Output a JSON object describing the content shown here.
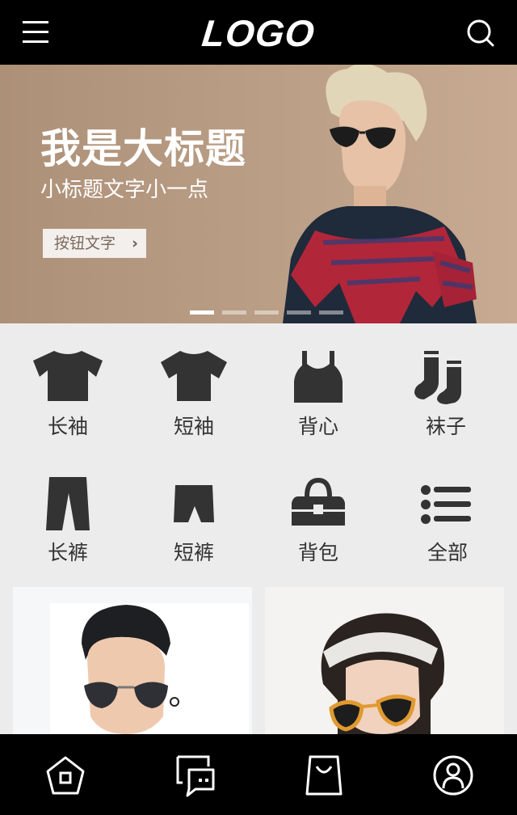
{
  "header": {
    "logo_text": "LOGO",
    "menu_icon": "menu-icon",
    "search_icon": "search-icon"
  },
  "banner": {
    "title": "我是大标题",
    "subtitle": "小标题文字小一点",
    "button_label": "按钮文字",
    "button_icon": "chevron-right-icon",
    "slides_total": 5,
    "active_slide": 1
  },
  "categories": [
    {
      "label": "长袖",
      "icon": "long-sleeve-shirt-icon"
    },
    {
      "label": "短袖",
      "icon": "t-shirt-icon"
    },
    {
      "label": "背心",
      "icon": "tank-top-icon"
    },
    {
      "label": "袜子",
      "icon": "socks-icon"
    },
    {
      "label": "长裤",
      "icon": "trousers-icon"
    },
    {
      "label": "短裤",
      "icon": "shorts-icon"
    },
    {
      "label": "背包",
      "icon": "handbag-icon"
    },
    {
      "label": "全部",
      "icon": "list-icon"
    }
  ],
  "bottom_nav": [
    {
      "name": "home",
      "icon": "home-icon"
    },
    {
      "name": "messages",
      "icon": "chat-icon"
    },
    {
      "name": "cart",
      "icon": "shopping-bag-icon"
    },
    {
      "name": "profile",
      "icon": "user-icon"
    }
  ],
  "colors": {
    "bar": "#000000",
    "banner_bg": "#b89c84",
    "page_bg": "#ececec",
    "icon": "#333333"
  }
}
